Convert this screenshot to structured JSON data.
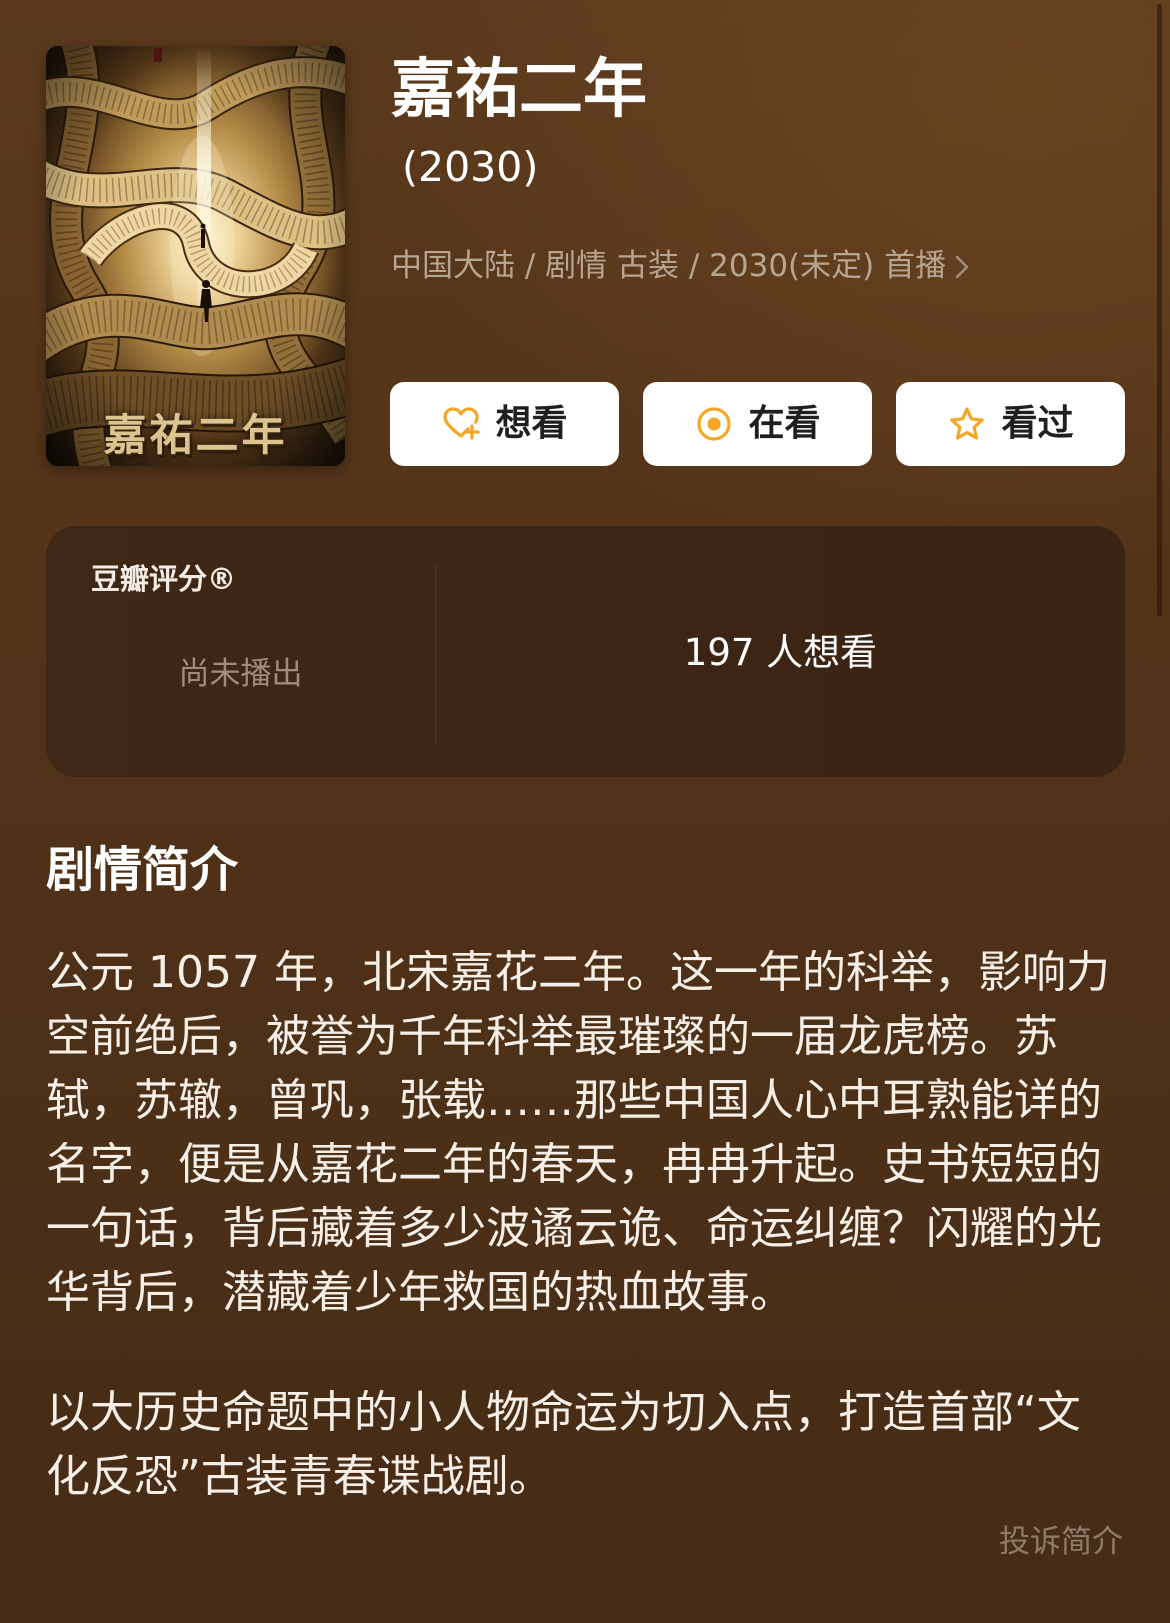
{
  "poster": {
    "title_art": "嘉祐二年"
  },
  "header": {
    "title": "嘉祐二年",
    "year": "(2030)",
    "meta": "中国大陆 / 剧情 古装 / 2030(未定) 首播",
    "meta_icon": "chevron-right-icon"
  },
  "actions": [
    {
      "label": "想看",
      "icon": "heart-plus-icon"
    },
    {
      "label": "在看",
      "icon": "target-icon"
    },
    {
      "label": "看过",
      "icon": "star-icon"
    }
  ],
  "rating": {
    "label": "豆瓣评分®",
    "status": "尚未播出",
    "wish_count": "197 人想看"
  },
  "synopsis": {
    "heading": "剧情简介",
    "paragraphs": [
      "公元 1057 年，北宋嘉花二年。这一年的科举，影响力空前绝后，被誉为千年科举最璀璨的一届龙虎榜。苏轼，苏辙，曾巩，张载……那些中国人心中耳熟能详的名字，便是从嘉花二年的春天，冉冉升起。史书短短的一句话，背后藏着多少波谲云诡、命运纠缠？闪耀的光华背后，潜藏着少年救国的热血故事。",
      "以大历史命题中的小人物命运为切入点，打造首部“文化反恐”古装青春谍战剧。"
    ],
    "report_link": "投诉简介"
  },
  "colors": {
    "accent": "#f5a623",
    "button_background": "#ffffff",
    "card_background": "#3e2615",
    "page_background": "#513218",
    "meta_text": "#b7a491"
  }
}
